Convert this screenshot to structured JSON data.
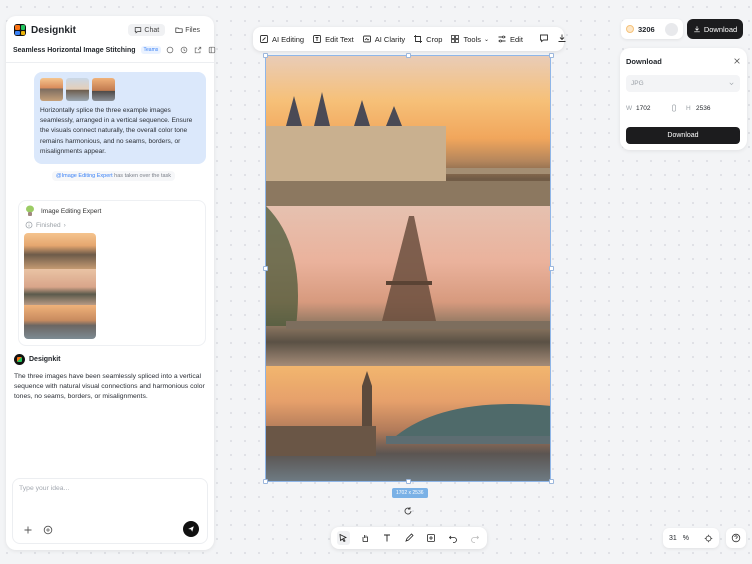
{
  "app": {
    "name": "Designkit"
  },
  "left_tabs": [
    {
      "label": "Chat"
    },
    {
      "label": "Files"
    }
  ],
  "chat": {
    "title": "Seamless Horizontal Image Stitching",
    "tag": "Teams"
  },
  "user_message": {
    "text": "Horizontally splice the three example images seamlessly, arranged in a vertical sequence. Ensure the visuals connect naturally, the overall color tone remains harmonious, and no seams, borders, or misalignments appear."
  },
  "handover": {
    "agent": "@Image Editing Expert",
    "text": "has taken over the task"
  },
  "expert": {
    "name": "Image Editing Expert",
    "status": "Finished"
  },
  "reply": {
    "author": "Designkit",
    "text": "The three images have been seamlessly spliced into a vertical sequence with natural visual connections and harmonious color tones, no seams, borders, or misalignments."
  },
  "input": {
    "placeholder": "Type your idea..."
  },
  "toolbar": {
    "ai_editing": "AI Editing",
    "edit_text": "Edit Text",
    "ai_clarity": "AI Clarity",
    "crop": "Crop",
    "tools": "Tools",
    "edit": "Edit"
  },
  "canvas": {
    "dimensions": "1702 x 2536"
  },
  "account": {
    "credits": "3206",
    "download_label": "Download"
  },
  "download_panel": {
    "title": "Download",
    "format": "JPG",
    "width_label": "W",
    "width": "1702",
    "height_label": "H",
    "height": "2536",
    "button": "Download"
  },
  "zoom": {
    "value": "31",
    "unit": "%"
  },
  "colors": {
    "accent_blue": "#3b82f6",
    "dark": "#1c1c1e",
    "user_bubble": "#dbe8fb"
  }
}
